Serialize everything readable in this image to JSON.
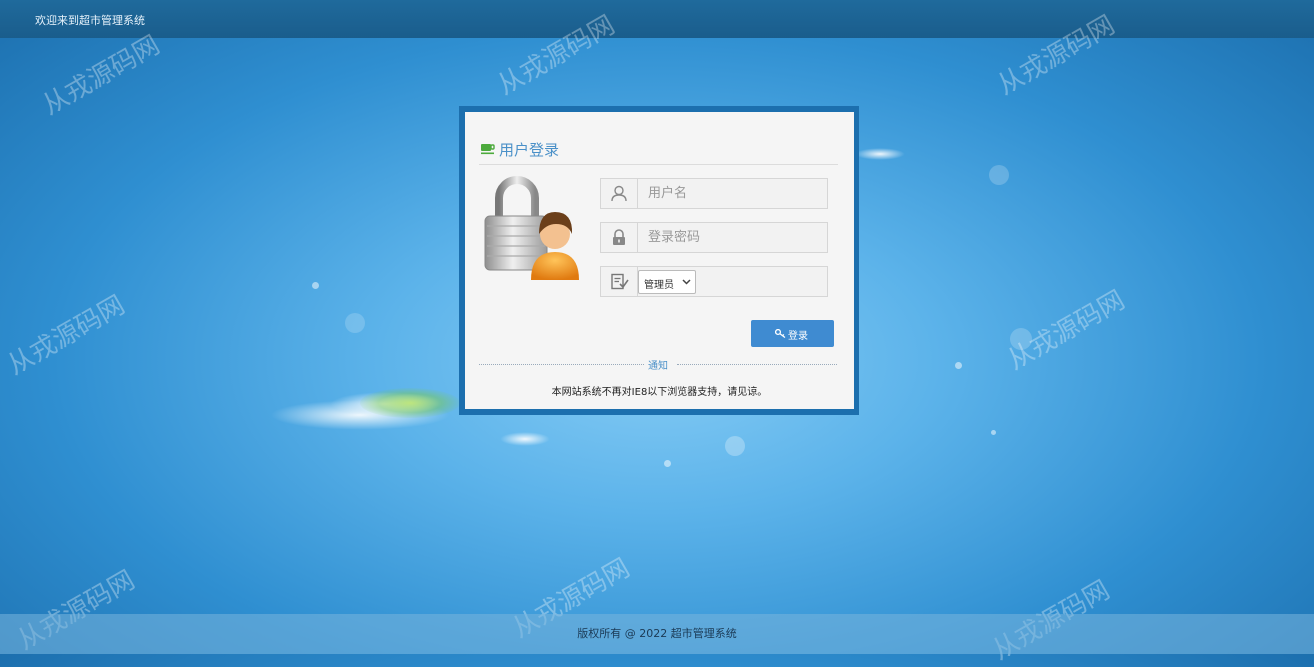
{
  "header": {
    "welcome": "欢迎来到超市管理系统"
  },
  "watermark": {
    "text": "从戎源码网"
  },
  "login": {
    "title": "用户登录",
    "username_placeholder": "用户名",
    "password_placeholder": "登录密码",
    "role_selected": "管理员",
    "login_label": "登录"
  },
  "notice": {
    "label": "通知",
    "text": "本网站系统不再对IE8以下浏览器支持，请见谅。"
  },
  "footer": {
    "copyright": "版权所有 @ 2022 超市管理系统"
  },
  "colors": {
    "accent": "#3f8bd1",
    "frame": "#1c6fae",
    "title": "#4a90c8"
  }
}
